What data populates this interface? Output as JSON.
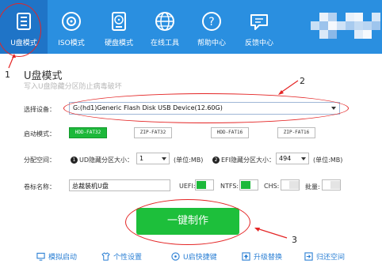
{
  "nav": {
    "items": [
      {
        "label": "U盘模式",
        "icon": "usb-drive-icon"
      },
      {
        "label": "ISO模式",
        "icon": "disc-icon"
      },
      {
        "label": "硬盘模式",
        "icon": "hard-disk-icon"
      },
      {
        "label": "在线工具",
        "icon": "globe-icon"
      },
      {
        "label": "帮助中心",
        "icon": "help-icon"
      },
      {
        "label": "反馈中心",
        "icon": "feedback-icon"
      }
    ],
    "active_index": 0
  },
  "annotations": {
    "n1": "1",
    "n2": "2",
    "n3": "3"
  },
  "mode": {
    "title": "U盘模式",
    "subtitle": "写入U盘隐藏分区防止病毒破坏"
  },
  "device": {
    "label": "选择设备：",
    "value": "G:(hd1)Generic Flash Disk USB Device(12.60G)"
  },
  "boot": {
    "label": "启动模式：",
    "options": [
      "HDD-FAT32",
      "ZIP-FAT32",
      "HDD-FAT16",
      "ZIP-FAT16"
    ],
    "selected_index": 0
  },
  "partition": {
    "label": "分配空间：",
    "ud_num": "1",
    "ud_label": "UD隐藏分区大小：",
    "ud_value": "1",
    "ud_unit": "(单位:MB)",
    "efi_num": "2",
    "efi_label": "EFI隐藏分区大小：",
    "efi_value": "494",
    "efi_unit": "(单位:MB)"
  },
  "volume": {
    "label": "卷标名称：",
    "value": "总裁装机U盘",
    "uefi_label": "UEFI:",
    "uefi_on": true,
    "ntfs_label": "NTFS:",
    "ntfs_on": true,
    "chs_label": "CHS:",
    "chs_on": false,
    "batch_label": "批量:",
    "batch_on": false
  },
  "make_button": {
    "label": "一键制作"
  },
  "bottom": {
    "items": [
      {
        "label": "模拟启动",
        "icon": "monitor-icon"
      },
      {
        "label": "个性设置",
        "icon": "shirt-icon"
      },
      {
        "label": "U启快捷键",
        "icon": "keyboard-icon"
      },
      {
        "label": "升级替换",
        "icon": "upgrade-icon"
      },
      {
        "label": "归还空间",
        "icon": "restore-icon"
      }
    ]
  },
  "colors": {
    "topbar": "#2a8fe0",
    "accent_green": "#1dbf3b",
    "annotation_red": "#e42525",
    "link_blue": "#2a7fd4"
  }
}
